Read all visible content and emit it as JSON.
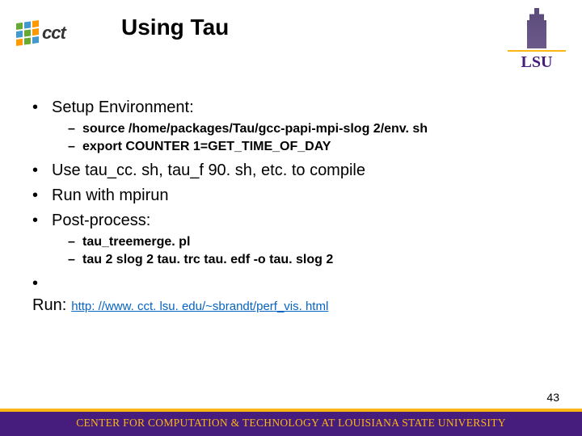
{
  "header": {
    "logo_text": "cct",
    "title": "Using Tau",
    "lsu_text": "LSU"
  },
  "bullets": {
    "b1": "Setup Environment:",
    "b1_sub1": "source /home/packages/Tau/gcc-papi-mpi-slog 2/env. sh",
    "b1_sub2": "export COUNTER 1=GET_TIME_OF_DAY",
    "b2": "Use tau_cc. sh, tau_f 90. sh, etc. to compile",
    "b3": "Run with mpirun",
    "b4": "Post-process:",
    "b4_sub1": "tau_treemerge. pl",
    "b4_sub2": "tau 2 slog 2 tau. trc tau. edf -o tau. slog 2",
    "b5": "Run:",
    "b5_link": "http: //www. cct. lsu. edu/~sbrandt/perf_vis. html"
  },
  "page_number": "43",
  "footer": "CENTER FOR COMPUTATION & TECHNOLOGY AT LOUISIANA STATE UNIVERSITY"
}
